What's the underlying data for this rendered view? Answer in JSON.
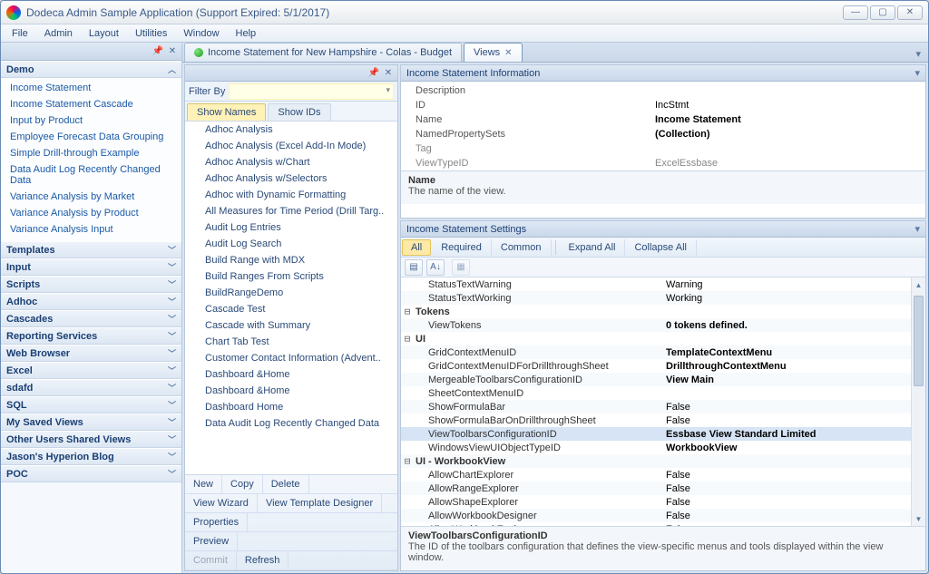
{
  "window": {
    "title": "Dodeca Admin Sample Application (Support Expired: 5/1/2017)"
  },
  "menu": [
    "File",
    "Admin",
    "Layout",
    "Utilities",
    "Window",
    "Help"
  ],
  "sidebar": {
    "sections": [
      {
        "title": "Demo",
        "expanded": true,
        "items": [
          "Income Statement",
          "Income Statement Cascade",
          "Input by Product",
          "Employee Forecast Data Grouping",
          "Simple Drill-through Example",
          "Data Audit Log Recently Changed Data",
          "Variance Analysis by Market",
          "Variance Analysis by Product",
          "Variance Analysis Input"
        ]
      },
      {
        "title": "Templates",
        "expanded": false
      },
      {
        "title": "Input",
        "expanded": false
      },
      {
        "title": "Scripts",
        "expanded": false
      },
      {
        "title": "Adhoc",
        "expanded": false
      },
      {
        "title": "Cascades",
        "expanded": false
      },
      {
        "title": "Reporting Services",
        "expanded": false
      },
      {
        "title": "Web Browser",
        "expanded": false
      },
      {
        "title": "Excel",
        "expanded": false
      },
      {
        "title": "sdafd",
        "expanded": false
      },
      {
        "title": "SQL",
        "expanded": false
      },
      {
        "title": "My Saved Views",
        "expanded": false
      },
      {
        "title": "Other Users Shared Views",
        "expanded": false
      },
      {
        "title": "Jason's Hyperion Blog",
        "expanded": false
      },
      {
        "title": "POC",
        "expanded": false
      }
    ]
  },
  "docTabs": {
    "inactive": "Income Statement for New Hampshire - Colas - Budget",
    "active": "Views"
  },
  "filter": {
    "label": "Filter By"
  },
  "listTabs": {
    "a": "Show Names",
    "b": "Show IDs"
  },
  "viewList": [
    "Adhoc Analysis",
    "Adhoc Analysis (Excel Add-In Mode)",
    "Adhoc Analysis w/Chart",
    "Adhoc Analysis w/Selectors",
    "Adhoc with Dynamic Formatting",
    "All Measures for Time Period (Drill Targ..",
    "Audit Log Entries",
    "Audit Log Search",
    "Build Range with MDX",
    "Build Ranges From Scripts",
    "BuildRangeDemo",
    "Cascade Test",
    "Cascade with Summary",
    "Chart Tab Test",
    "Customer Contact Information (Advent..",
    "Dashboard &Home",
    "Dashboard &Home",
    "Dashboard Home",
    "Data Audit Log Recently Changed Data"
  ],
  "buttons": {
    "row1": [
      "New",
      "Copy",
      "Delete"
    ],
    "row2": [
      "View Wizard",
      "View Template Designer"
    ],
    "row3": [
      "Properties"
    ],
    "row4": [
      "Preview"
    ],
    "row5": [
      "Commit",
      "Refresh"
    ]
  },
  "infoPane": {
    "title": "Income Statement Information",
    "rows": [
      {
        "k": "Description",
        "v": ""
      },
      {
        "k": "ID",
        "v": "IncStmt"
      },
      {
        "k": "Name",
        "v": "Income Statement",
        "bold": true
      },
      {
        "k": "NamedPropertySets",
        "v": "(Collection)",
        "bold": true
      },
      {
        "k": "Tag",
        "v": "",
        "gray": true
      },
      {
        "k": "ViewTypeID",
        "v": "ExcelEssbase",
        "gray": true
      }
    ],
    "help": {
      "title": "Name",
      "text": "The name of the view."
    }
  },
  "settingsPane": {
    "title": "Income Statement Settings",
    "tabs": [
      "All",
      "Required",
      "Common"
    ],
    "actions": [
      "Expand All",
      "Collapse All"
    ],
    "rows": [
      {
        "k": "StatusTextWarning",
        "v": "Warning",
        "indent": true
      },
      {
        "k": "StatusTextWorking",
        "v": "Working",
        "indent": true
      },
      {
        "cat": true,
        "k": "Tokens"
      },
      {
        "k": "ViewTokens",
        "v": "0 tokens defined.",
        "indent": true,
        "bold": true
      },
      {
        "cat": true,
        "k": "UI"
      },
      {
        "k": "GridContextMenuID",
        "v": "TemplateContextMenu",
        "indent": true,
        "bold": true
      },
      {
        "k": "GridContextMenuIDForDrillthroughSheet",
        "v": "DrillthroughContextMenu",
        "indent": true,
        "bold": true
      },
      {
        "k": "MergeableToolbarsConfigurationID",
        "v": "View Main",
        "indent": true,
        "bold": true
      },
      {
        "k": "SheetContextMenuID",
        "v": "",
        "indent": true
      },
      {
        "k": "ShowFormulaBar",
        "v": "False",
        "indent": true
      },
      {
        "k": "ShowFormulaBarOnDrillthroughSheet",
        "v": "False",
        "indent": true
      },
      {
        "k": "ViewToolbarsConfigurationID",
        "v": "Essbase View Standard Limited",
        "indent": true,
        "bold": true,
        "sel": true
      },
      {
        "k": "WindowsViewUIObjectTypeID",
        "v": "WorkbookView",
        "indent": true,
        "bold": true
      },
      {
        "cat": true,
        "k": "UI - WorkbookView"
      },
      {
        "k": "AllowChartExplorer",
        "v": "False",
        "indent": true
      },
      {
        "k": "AllowRangeExplorer",
        "v": "False",
        "indent": true
      },
      {
        "k": "AllowShapeExplorer",
        "v": "False",
        "indent": true
      },
      {
        "k": "AllowWorkbookDesigner",
        "v": "False",
        "indent": true
      },
      {
        "k": "AllowWorkbookExplorer",
        "v": "False",
        "indent": true
      }
    ],
    "help": {
      "title": "ViewToolbarsConfigurationID",
      "text": "The ID of the toolbars configuration that defines the view-specific menus and tools displayed within the view window."
    }
  }
}
